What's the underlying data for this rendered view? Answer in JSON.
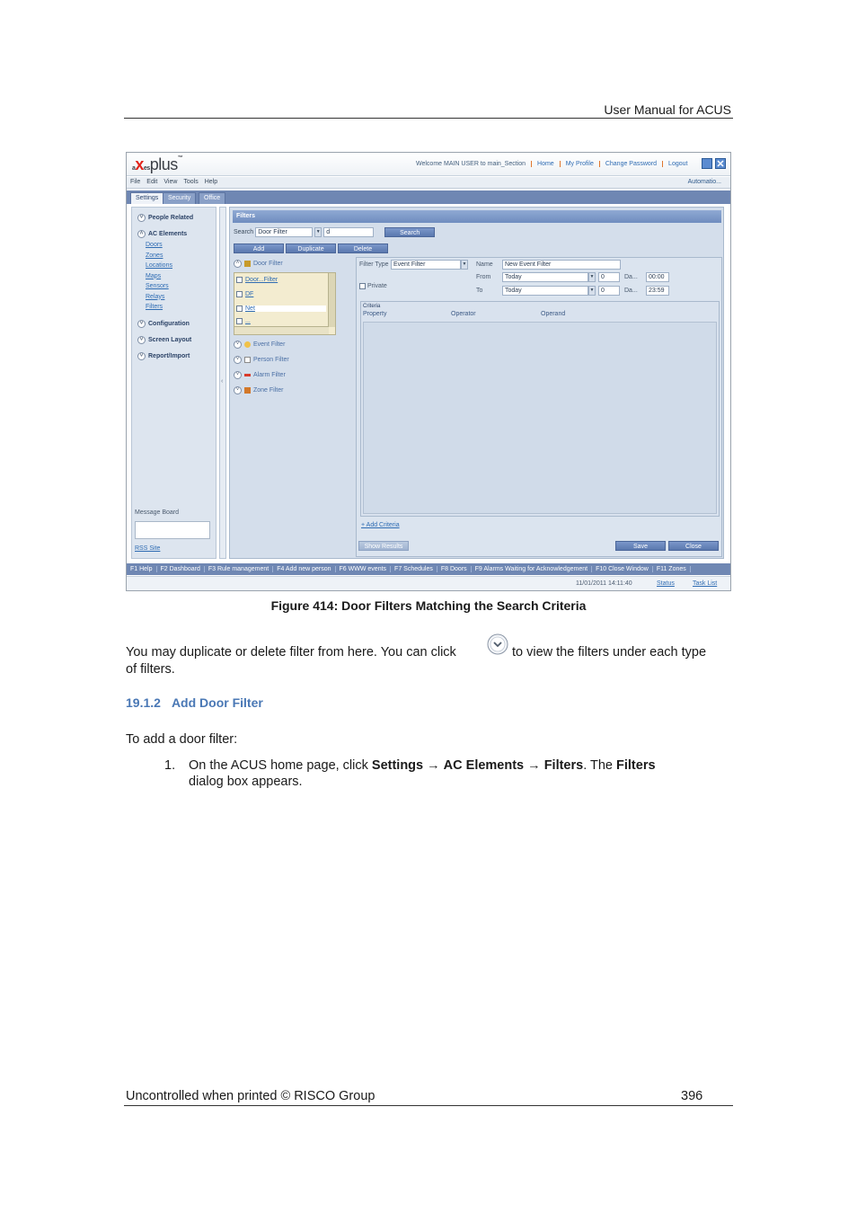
{
  "header": {
    "title": "User Manual for ACUS"
  },
  "screenshot": {
    "logo": {
      "brand_a": "a",
      "brand_x": "x",
      "brand_b": "es",
      "brand_plus": "plus",
      "tm": "™"
    },
    "top_links": [
      "Welcome MAIN USER  to main_Section",
      "Home",
      "My Profile",
      "Change Password",
      "Logout"
    ],
    "menu": [
      "File",
      "Edit",
      "View",
      "Tools",
      "Help"
    ],
    "automation": "Automatio...",
    "tabs": [
      "Settings",
      "Security",
      "Office"
    ],
    "sidebar": {
      "sections": [
        "People Related",
        "AC Elements",
        "Configuration",
        "Screen Layout",
        "Report/Import"
      ],
      "links": [
        "Doors",
        "Zones",
        "Locations",
        "Maps",
        "Sensors",
        "Relays",
        "Filters"
      ],
      "message_board": "Message Board",
      "rss": "RSS Site"
    },
    "divider_arrow": "‹",
    "filters": {
      "title": "Filters",
      "search_label": "Search",
      "search_type": "Door Filter",
      "search_value": "d",
      "search_button": "Search",
      "actions": [
        "Add",
        "Duplicate",
        "Delete"
      ],
      "tree_root": "Door Filter",
      "door_items": [
        "Door...Filter",
        "DF",
        "Net",
        "..."
      ],
      "other_filters": [
        "Event Filter",
        "Person Filter",
        "Alarm Filter",
        "Zone Filter"
      ],
      "filter_type_label": "Filter Type",
      "filter_type_value": "Event Filter",
      "name_label": "Name",
      "name_value": "New Event Filter",
      "private_label": "Private",
      "from_label": "From",
      "from_value": "Today",
      "from_num": "0",
      "from_da": "Da...",
      "from_time": "00:00",
      "to_label": "To",
      "to_value": "Today",
      "to_num": "0",
      "to_da": "Da...",
      "to_time": "23:59",
      "criteria_label": "Criteria",
      "criteria_columns": [
        "Property",
        "Operator",
        "Operand"
      ],
      "add_criteria": "+ Add Criteria",
      "show_results": "Show Results",
      "save": "Save",
      "close": "Close"
    },
    "function_keys": [
      "F1 Help",
      "F2 Dashboard",
      "F3 Rule management",
      "F4 Add new person",
      "F6 WWW events",
      "F7 Schedules",
      "F8 Doors",
      "F9 Alarms Waiting for Acknowledgement",
      "F10 Close Window",
      "F11 Zones"
    ],
    "status": {
      "datetime": "11/01/2011 14:11:40",
      "status_link": "Status",
      "task_list": "Task List"
    },
    "colors": {
      "accent": "#6f87b3",
      "logo_x": "#e2231a",
      "link": "#2f6cb3"
    }
  },
  "caption": "Figure 414: Door Filters Matching the Search Criteria",
  "paragraph": {
    "part1": "You may duplicate or delete filter from here. You can click",
    "part2": "to view the filters under each type",
    "part3": "of filters.",
    "icon": "chevron-down-icon"
  },
  "section": {
    "number": "19.1.2",
    "title": "Add Door Filter"
  },
  "intro": "To add a door filter:",
  "step": {
    "number": "1.",
    "t1": "On the ACUS home page, click ",
    "b1": "Settings",
    "arrow": " → ",
    "b2": "AC Elements",
    "b3": "Filters",
    "t2": ". The ",
    "b4": "Filters",
    "t3": "dialog box appears."
  },
  "footer": {
    "left": "Uncontrolled when printed © RISCO Group",
    "page": "396"
  }
}
